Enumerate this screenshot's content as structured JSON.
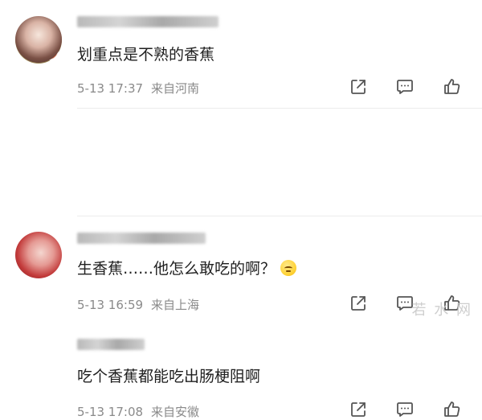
{
  "comments": [
    {
      "text": "划重点是不熟的香蕉",
      "time": "5-13 17:37",
      "location": "来自河南",
      "icons": [
        "share-icon",
        "comment-icon",
        "like-icon"
      ]
    },
    {
      "text": "吃个香蕉都能吃出肠梗阻啊",
      "time": "5-13 17:08",
      "location": "来自安徽",
      "icons": [
        "share-icon",
        "comment-icon",
        "like-icon"
      ]
    },
    {
      "text": "生香蕉……他怎么敢吃的啊？",
      "time": "5-13 16:59",
      "location": "来自上海",
      "icons": [
        "share-icon",
        "comment-icon",
        "like-icon"
      ]
    }
  ],
  "watermark": "若 水 网",
  "colors": {
    "text_primary": "#1f1f1f",
    "text_meta": "#8a8a8a",
    "icon": "#555555"
  }
}
